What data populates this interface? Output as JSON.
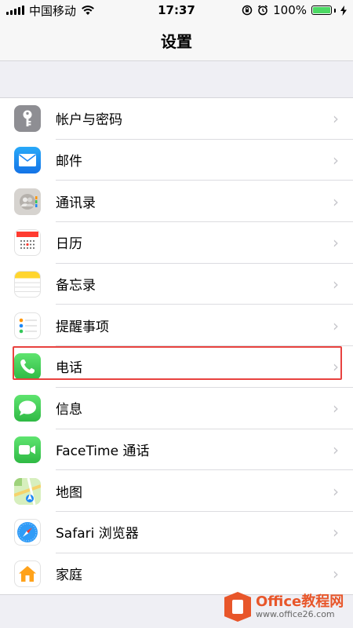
{
  "status_bar": {
    "carrier": "中国移动",
    "time": "17:37",
    "battery": "100%"
  },
  "nav": {
    "title": "设置"
  },
  "settings": [
    {
      "label": "帐户与密码",
      "icon": "key-icon",
      "color": "#8e8e93"
    },
    {
      "label": "邮件",
      "icon": "mail-icon",
      "color": "#1e88f5"
    },
    {
      "label": "通讯录",
      "icon": "contacts-icon",
      "color": "#c9c6c2"
    },
    {
      "label": "日历",
      "icon": "calendar-icon",
      "color": "#ffffff"
    },
    {
      "label": "备忘录",
      "icon": "notes-icon",
      "color": "#ffffff"
    },
    {
      "label": "提醒事项",
      "icon": "reminders-icon",
      "color": "#ffffff"
    },
    {
      "label": "电话",
      "icon": "phone-icon",
      "color": "#34c759"
    },
    {
      "label": "信息",
      "icon": "messages-icon",
      "color": "#34c759"
    },
    {
      "label": "FaceTime 通话",
      "icon": "facetime-icon",
      "color": "#34c759"
    },
    {
      "label": "地图",
      "icon": "maps-icon",
      "color": "#8fd06d"
    },
    {
      "label": "Safari 浏览器",
      "icon": "safari-icon",
      "color": "#ffffff"
    },
    {
      "label": "家庭",
      "icon": "home-icon",
      "color": "#ffffff"
    }
  ],
  "watermark": {
    "title": "Office教程网",
    "url": "www.office26.com"
  }
}
